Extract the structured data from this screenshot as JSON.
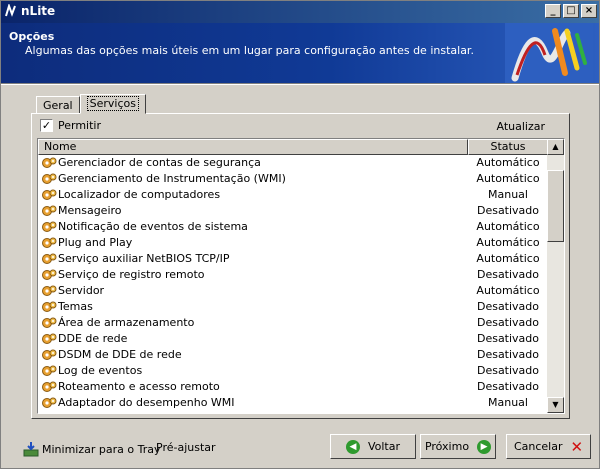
{
  "window": {
    "title": "nLite"
  },
  "header": {
    "title": "Opções",
    "subtitle": "Algumas das opções mais úteis em um lugar para configuração antes de instalar."
  },
  "tabs": [
    {
      "label": "Geral",
      "active": false
    },
    {
      "label": "Serviços",
      "active": true
    }
  ],
  "panel": {
    "permit_label": "Permitir",
    "permit_checked": true,
    "refresh_label": "Atualizar"
  },
  "list": {
    "columns": {
      "name": "Nome",
      "status": "Status"
    },
    "rows": [
      {
        "name": "Gerenciador de contas de segurança",
        "status": "Automático"
      },
      {
        "name": "Gerenciamento de Instrumentação (WMI)",
        "status": "Automático"
      },
      {
        "name": "Localizador de computadores",
        "status": "Manual"
      },
      {
        "name": "Mensageiro",
        "status": "Desativado"
      },
      {
        "name": "Notificação de eventos de sistema",
        "status": "Automático"
      },
      {
        "name": "Plug and Play",
        "status": "Automático"
      },
      {
        "name": "Serviço auxiliar NetBIOS TCP/IP",
        "status": "Automático"
      },
      {
        "name": "Serviço de registro remoto",
        "status": "Desativado"
      },
      {
        "name": "Servidor",
        "status": "Automático"
      },
      {
        "name": "Temas",
        "status": "Desativado"
      },
      {
        "name": "Área de armazenamento",
        "status": "Desativado"
      },
      {
        "name": "DDE de rede",
        "status": "Desativado"
      },
      {
        "name": "DSDM de DDE de rede",
        "status": "Desativado"
      },
      {
        "name": "Log de eventos",
        "status": "Desativado"
      },
      {
        "name": "Roteamento e acesso remoto",
        "status": "Desativado"
      },
      {
        "name": "Adaptador do desempenho WMI",
        "status": "Manual"
      }
    ]
  },
  "footer": {
    "minimize_label": "Minimizar para o Tray",
    "preset_label": "Pré-ajustar",
    "back_label": "Voltar",
    "next_label": "Próximo",
    "cancel_label": "Cancelar"
  },
  "colors": {
    "header_bg": "#103a96",
    "title_bar": "#0a246a",
    "face": "#d4d0c8",
    "nav_green": "#2e9a2e",
    "cancel_red": "#d01010"
  }
}
